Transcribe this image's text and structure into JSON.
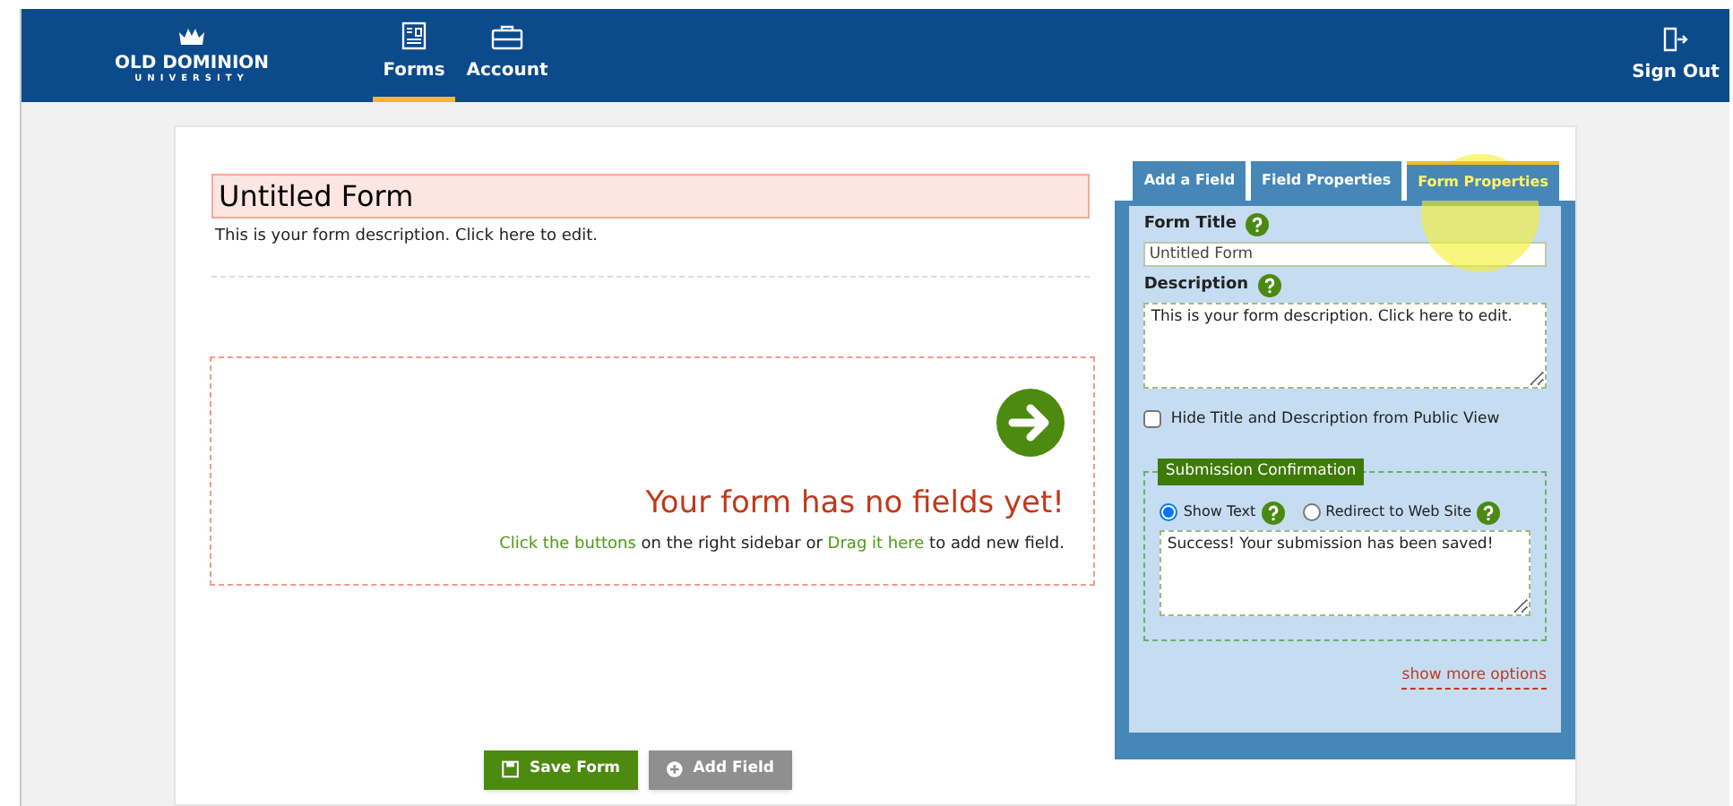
{
  "header": {
    "logo": {
      "name": "OLD DOMINION",
      "sub": "UNIVERSITY"
    },
    "nav": [
      {
        "label": "Forms",
        "kind": "form",
        "selected": true
      },
      {
        "label": "Account",
        "kind": "briefcase",
        "selected": false
      }
    ],
    "sign_out": "Sign Out"
  },
  "form": {
    "title": "Untitled Form",
    "description": "This is your form description. Click here to edit."
  },
  "empty_state": {
    "heading": "Your form has no fields yet!",
    "hint": [
      {
        "kind": "link",
        "text": "Click the buttons"
      },
      {
        "kind": "text",
        "text": " on the right sidebar or "
      },
      {
        "kind": "link",
        "text": "Drag it here"
      },
      {
        "kind": "text",
        "text": " to add new field."
      }
    ]
  },
  "buttons": [
    {
      "label": "Save Form",
      "kind": "primary"
    },
    {
      "label": "Add Field",
      "kind": "secondary"
    }
  ],
  "sidebar": {
    "tabs": [
      {
        "label": "Add a Field",
        "selected": false
      },
      {
        "label": "Field Properties",
        "selected": false
      },
      {
        "label": "Form Properties",
        "selected": true
      }
    ],
    "form_title_label": "Form Title",
    "form_title_value": "Untitled Form",
    "description_label": "Description",
    "description_value": "This is your form description. Click here to edit.",
    "hide_checkbox": {
      "label": "Hide Title and Description from Public View",
      "checked": false
    },
    "confirmation": {
      "legend": "Submission Confirmation",
      "options": [
        {
          "label": "Show Text",
          "selected": true
        },
        {
          "label": "Redirect to Web Site",
          "selected": false
        }
      ],
      "message": "Success! Your submission has been saved!"
    },
    "more_link": "show more options"
  }
}
